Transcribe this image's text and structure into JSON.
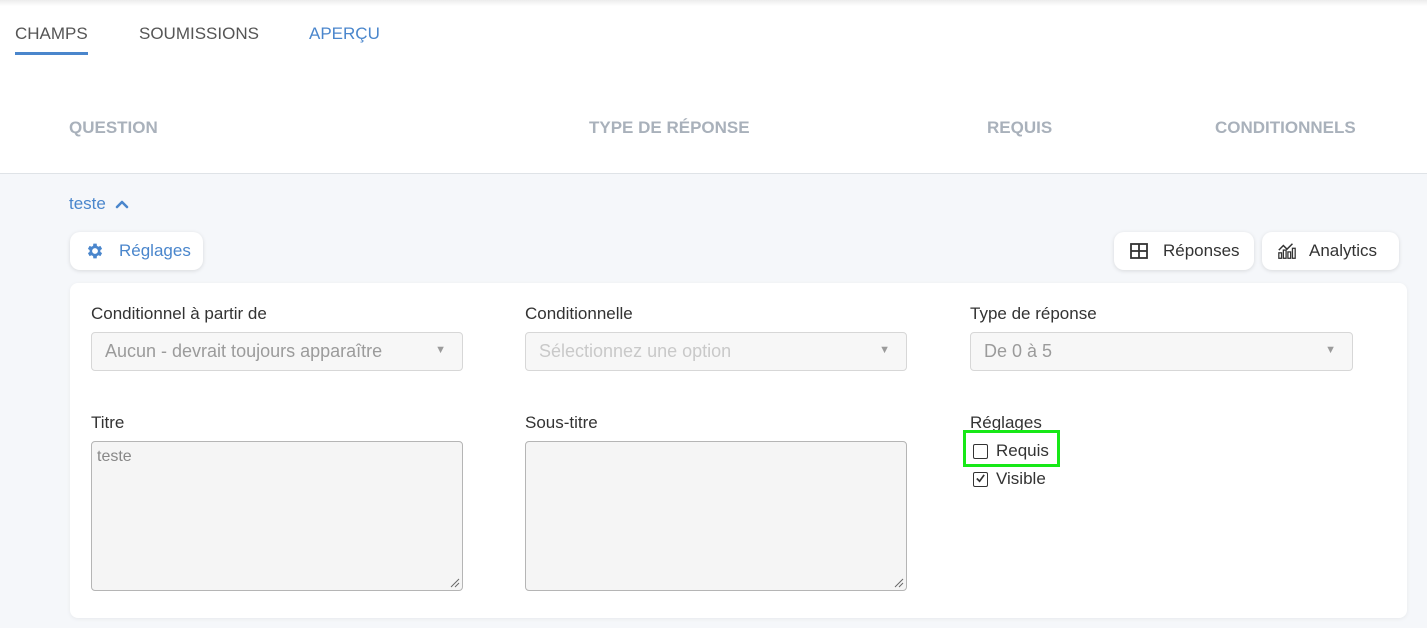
{
  "tabs": [
    {
      "label": "CHAMPS",
      "state": "active"
    },
    {
      "label": "SOUMISSIONS",
      "state": "normal"
    },
    {
      "label": "APERÇU",
      "state": "link"
    }
  ],
  "columns": {
    "question": "QUESTION",
    "type": "TYPE DE RÉPONSE",
    "required": "REQUIS",
    "conditional": "CONDITIONNELS"
  },
  "question": {
    "title": "teste",
    "expand_icon": "chevron-up-icon"
  },
  "toolbar": {
    "settings_label": "Réglages",
    "settings_icon": "gear-icon",
    "responses_label": "Réponses",
    "responses_icon": "table-icon",
    "analytics_label": "Analytics",
    "analytics_icon": "analytics-chart-icon"
  },
  "form": {
    "conditional_from": {
      "label": "Conditionnel à partir de",
      "value": "Aucun - devrait toujours apparaître"
    },
    "conditional": {
      "label": "Conditionnelle",
      "placeholder": "Sélectionnez une option"
    },
    "answer_type": {
      "label": "Type de réponse",
      "value": "De 0 à 5"
    },
    "title": {
      "label": "Titre",
      "value": "teste"
    },
    "subtitle": {
      "label": "Sous-titre",
      "value": ""
    },
    "settings": {
      "label": "Réglages",
      "required": {
        "label": "Requis",
        "checked": false
      },
      "visible": {
        "label": "Visible",
        "checked": true
      }
    }
  },
  "colors": {
    "accent": "#4a86cc",
    "highlight": "#17e817",
    "header_gray": "#a9b1bb"
  }
}
